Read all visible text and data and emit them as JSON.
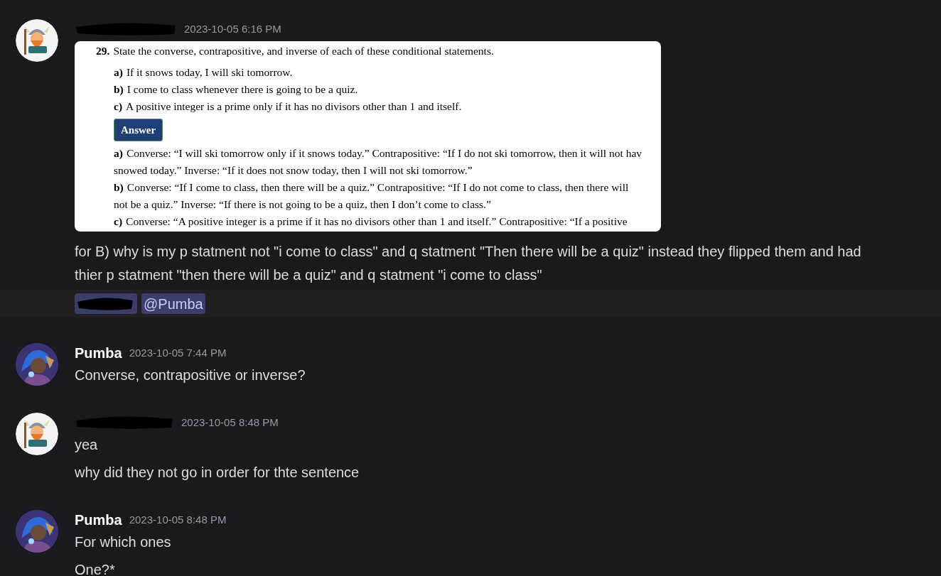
{
  "messages": [
    {
      "author": {
        "redacted": true,
        "color": "#f4f4f4"
      },
      "timestamp": "2023-10-05 6:16 PM",
      "attachment": {
        "problem": {
          "number": "29.",
          "text": "State the converse, contrapositive, and inverse of each of these conditional statements."
        },
        "items": [
          {
            "label": "a)",
            "text": "If it snows today, I will ski tomorrow."
          },
          {
            "label": "b)",
            "text": "I come to class whenever there is going to be a quiz."
          },
          {
            "label": "c)",
            "text": "A positive integer is a prime only if it has no divisors other than 1 and itself."
          }
        ],
        "button": "Answer",
        "answer_lines": [
          {
            "label": "a)",
            "text": "Converse: “I will ski tomorrow only if it snows today.” Contrapositive: “If I do not ski tomorrow, then it will not hav"
          },
          {
            "text": "snowed today.” Inverse: “If it does not snow today, then I will not ski tomorrow.”"
          },
          {
            "label": "b)",
            "text": "Converse: “If I come to class, then there will be a quiz.” Contrapositive: “If I do not come to class, then there will"
          },
          {
            "text": "not be a quiz.” Inverse: “If there is not going to be a quiz, then I don’t come to class.”"
          },
          {
            "label": "c)",
            "text": "Converse: “A positive integer is a prime if it has no divisors other than 1 and itself.” Contrapositive: “If a positive"
          }
        ]
      },
      "lines": [
        "for B) why is my p statment not \"i come to class\" and q statment \"Then there will be a quiz\" instead they flipped them and had thier p statment \"then there will be a quiz\" and q statment \"i come to class\""
      ],
      "mentions": [
        {
          "redacted": true
        },
        {
          "redacted": false,
          "label": "@Pumba"
        }
      ]
    },
    {
      "author": {
        "redacted": false,
        "name": "Pumba",
        "color": "#3a3475"
      },
      "timestamp": "2023-10-05 7:44 PM",
      "lines": [
        "Converse, contrapositive or inverse?"
      ]
    },
    {
      "author": {
        "redacted": true,
        "color": "#f4f4f4"
      },
      "timestamp": "2023-10-05 8:48 PM",
      "lines": [
        "yea",
        "why did they not go in order for thte sentence"
      ]
    },
    {
      "author": {
        "redacted": false,
        "name": "Pumba",
        "color": "#3a3475"
      },
      "timestamp": "2023-10-05 8:48 PM",
      "lines": [
        "For which ones",
        "One?*"
      ]
    }
  ]
}
